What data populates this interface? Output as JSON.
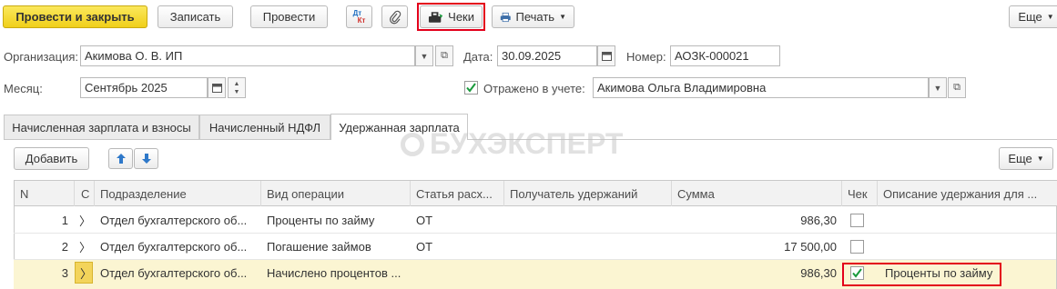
{
  "toolbar": {
    "post_close": "Провести и закрыть",
    "save": "Записать",
    "post": "Провести",
    "dt_icon_top": "Дт",
    "dt_icon_bottom": "Кт",
    "receipts": "Чеки",
    "print": "Печать",
    "more": "Еще"
  },
  "header": {
    "org_label": "Организация:",
    "org_value": "Акимова О. В. ИП",
    "date_label": "Дата:",
    "date_value": "30.09.2025",
    "number_label": "Номер:",
    "number_value": "АОЗК-000021",
    "month_label": "Месяц:",
    "month_value": "Сентябрь 2025",
    "reflected_label": "Отражено в учете:",
    "reflected_checked": true,
    "responsible_value": "Акимова Ольга Владимировна"
  },
  "tabs": [
    "Начисленная зарплата и взносы",
    "Начисленный НДФЛ",
    "Удержанная зарплата"
  ],
  "watermark": "БУХЭКСПЕРТ",
  "table_toolbar": {
    "add": "Добавить",
    "more": "Еще"
  },
  "table": {
    "columns": [
      "N",
      "С",
      "Подразделение",
      "Вид операции",
      "Статья расх...",
      "Получатель удержаний",
      "Сумма",
      "Чек",
      "Описание удержания для ..."
    ],
    "rows": [
      {
        "n": "1",
        "c": "〉",
        "dept": "Отдел бухгалтерского об...",
        "op": "Проценты по займу",
        "art": "ОТ",
        "recipient": "",
        "sum": "986,30",
        "check": false,
        "desc": ""
      },
      {
        "n": "2",
        "c": "〉",
        "dept": "Отдел бухгалтерского об...",
        "op": "Погашение займов",
        "art": "ОТ",
        "recipient": "",
        "sum": "17 500,00",
        "check": false,
        "desc": ""
      },
      {
        "n": "3",
        "c": "〉",
        "dept": "Отдел бухгалтерского об...",
        "op": "Начислено процентов ...",
        "art": "",
        "recipient": "",
        "sum": "986,30",
        "check": true,
        "desc": "Проценты по займу"
      }
    ]
  },
  "colors": {
    "accent_yellow": "#f4d62a",
    "highlight_row": "#fbf5d2",
    "red_frame": "#e3001b",
    "check_green": "#1a9a3c"
  }
}
